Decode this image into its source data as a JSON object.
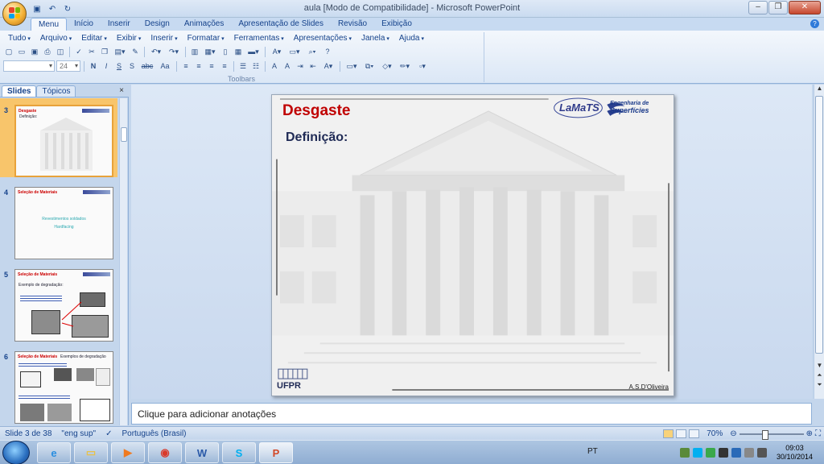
{
  "window": {
    "title": "aula [Modo de Compatibilidade] - Microsoft PowerPoint"
  },
  "tabs": [
    "Menu",
    "Início",
    "Inserir",
    "Design",
    "Animações",
    "Apresentação de Slides",
    "Revisão",
    "Exibição"
  ],
  "menus": [
    "Tudo",
    "Arquivo",
    "Editar",
    "Exibir",
    "Inserir",
    "Formatar",
    "Ferramentas",
    "Apresentações",
    "Janela",
    "Ajuda"
  ],
  "toolbar": {
    "font_size": "24",
    "group_label": "Toolbars",
    "row1_icons": [
      "new-icon",
      "open-icon",
      "save-icon",
      "print-icon",
      "print-preview-icon",
      "spell-icon",
      "cut-icon",
      "copy-icon",
      "paste-icon",
      "format-painter-icon",
      "undo-icon",
      "redo-icon",
      "chart-icon",
      "table-icon",
      "columns-icon",
      "grid-icon",
      "zoom-icon",
      "help-icon"
    ],
    "row2_labels": [
      "N",
      "I",
      "S",
      "S",
      "abc",
      "Aa"
    ]
  },
  "panel": {
    "tabs": [
      "Slides",
      "Tópicos"
    ],
    "close": "×"
  },
  "thumbnails": [
    {
      "num": "3",
      "title": "Desgaste",
      "sub": "Definição:",
      "body": []
    },
    {
      "num": "4",
      "title": "Seleção de Materiais",
      "sub": "",
      "body": [
        "Revestimentos soldados",
        "Hardfacing"
      ]
    },
    {
      "num": "5",
      "title": "Seleção de Materiais",
      "sub": "Exemplo de degradação:",
      "body": []
    },
    {
      "num": "6",
      "title": "Seleção de Materiais",
      "sub": "Exemplos de degradação",
      "body": []
    }
  ],
  "slide": {
    "title": "Desgaste",
    "subtitle": "Definição:",
    "logo_left": "LaMaTS",
    "logo_right_line1": "Engenharia de",
    "logo_right_line2": "Superfícies",
    "footer_logo": "UFPR",
    "author": "A.S.D'Oliveira"
  },
  "notes": {
    "placeholder": "Clique para adicionar anotações"
  },
  "status": {
    "slide": "Slide 3 de 38",
    "theme": "\"eng sup\"",
    "language": "Português (Brasil)",
    "zoom": "70%"
  },
  "taskbar": {
    "apps": [
      "ie-icon",
      "explorer-icon",
      "media-player-icon",
      "chrome-icon",
      "word-icon",
      "skype-icon",
      "powerpoint-icon"
    ],
    "lang": "PT",
    "time": "09:03",
    "date": "30/10/2014"
  },
  "colors": {
    "accent": "#15428b",
    "slide_title": "#c00000",
    "selected_thumb": "#f8c56b"
  }
}
